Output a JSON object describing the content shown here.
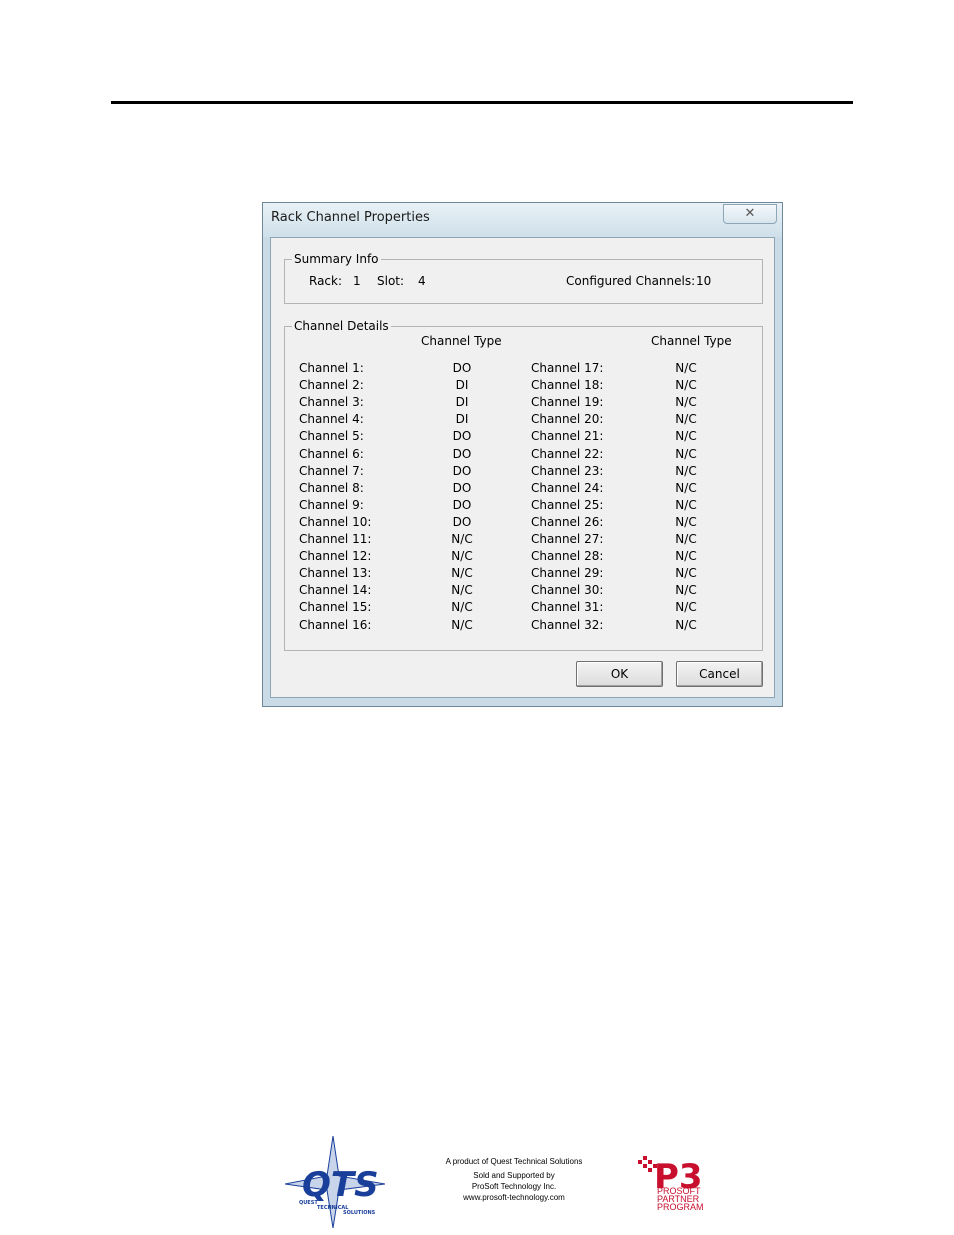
{
  "dialog": {
    "title": "Rack Channel Properties",
    "close_label": "✕"
  },
  "summary": {
    "legend": "Summary Info",
    "rack_label": "Rack:",
    "rack_value": "1",
    "slot_label": "Slot:",
    "slot_value": "4",
    "configured_label": "Configured Channels:",
    "configured_value": "10"
  },
  "details": {
    "legend": "Channel Details",
    "col_header_left": "Channel Type",
    "col_header_right": "Channel Type",
    "left_channels": [
      {
        "name": "Channel 1:",
        "type": "DO"
      },
      {
        "name": "Channel 2:",
        "type": "DI"
      },
      {
        "name": "Channel 3:",
        "type": "DI"
      },
      {
        "name": "Channel 4:",
        "type": "DI"
      },
      {
        "name": "Channel 5:",
        "type": "DO"
      },
      {
        "name": "Channel 6:",
        "type": "DO"
      },
      {
        "name": "Channel 7:",
        "type": "DO"
      },
      {
        "name": "Channel 8:",
        "type": "DO"
      },
      {
        "name": "Channel 9:",
        "type": "DO"
      },
      {
        "name": "Channel 10:",
        "type": "DO"
      },
      {
        "name": "Channel 11:",
        "type": "N/C"
      },
      {
        "name": "Channel 12:",
        "type": "N/C"
      },
      {
        "name": "Channel 13:",
        "type": "N/C"
      },
      {
        "name": "Channel 14:",
        "type": "N/C"
      },
      {
        "name": "Channel 15:",
        "type": "N/C"
      },
      {
        "name": "Channel 16:",
        "type": "N/C"
      }
    ],
    "right_channels": [
      {
        "name": "Channel 17:",
        "type": "N/C"
      },
      {
        "name": "Channel 18:",
        "type": "N/C"
      },
      {
        "name": "Channel 19:",
        "type": "N/C"
      },
      {
        "name": "Channel 20:",
        "type": "N/C"
      },
      {
        "name": "Channel 21:",
        "type": "N/C"
      },
      {
        "name": "Channel 22:",
        "type": "N/C"
      },
      {
        "name": "Channel 23:",
        "type": "N/C"
      },
      {
        "name": "Channel 24:",
        "type": "N/C"
      },
      {
        "name": "Channel 25:",
        "type": "N/C"
      },
      {
        "name": "Channel 26:",
        "type": "N/C"
      },
      {
        "name": "Channel 27:",
        "type": "N/C"
      },
      {
        "name": "Channel 28:",
        "type": "N/C"
      },
      {
        "name": "Channel 29:",
        "type": "N/C"
      },
      {
        "name": "Channel 30:",
        "type": "N/C"
      },
      {
        "name": "Channel 31:",
        "type": "N/C"
      },
      {
        "name": "Channel 32:",
        "type": "N/C"
      }
    ]
  },
  "buttons": {
    "ok": "OK",
    "cancel": "Cancel"
  },
  "footer": {
    "line1": "A product of Quest Technical Solutions",
    "line2": "Sold and Supported by",
    "line3": "ProSoft Technology Inc.",
    "line4": "www.prosoft-technology.com",
    "qts_logo_text": "QTS",
    "qts_logo_sub": [
      "QUEST",
      "TECHNICAL",
      "SOLUTIONS"
    ],
    "p3_logo_text": "P3",
    "p3_logo_lines": [
      "PROSOFT",
      "PARTNER",
      "PROGRAM"
    ]
  },
  "colors": {
    "logo_blue": "#1a3f9a",
    "logo_red": "#c8102e"
  }
}
